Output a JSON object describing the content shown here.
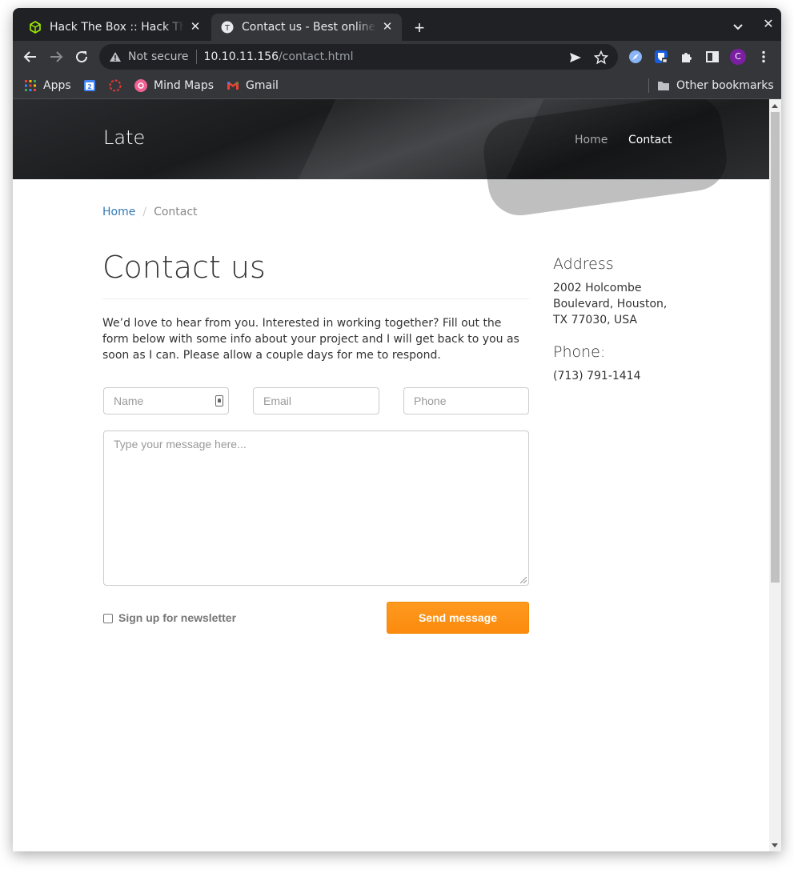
{
  "browser": {
    "tabs": [
      {
        "title": "Hack The Box :: Hack The Box",
        "icon": "hackthebox-cube-icon",
        "active": false
      },
      {
        "title": "Contact us - Best online image",
        "icon": "page-favicon-icon",
        "active": true
      }
    ],
    "url": {
      "security": "Not secure",
      "host": "10.10.11.156",
      "path": "/contact.html"
    },
    "bookmarks": [
      {
        "label": "Apps",
        "icon": "apps-grid-icon"
      },
      {
        "label": "",
        "icon": "google-calendar-icon"
      },
      {
        "label": "",
        "icon": "target-icon"
      },
      {
        "label": "Mind Maps",
        "icon": "mindmaps-icon"
      },
      {
        "label": "Gmail",
        "icon": "gmail-icon"
      }
    ],
    "other_bookmarks": "Other bookmarks",
    "profile_initial": "C"
  },
  "site": {
    "brand": "Late",
    "nav": {
      "home": "Home",
      "contact": "Contact"
    }
  },
  "breadcrumb": {
    "home": "Home",
    "separator": "/",
    "current": "Contact"
  },
  "page": {
    "title": "Contact us",
    "intro": "We’d love to hear from you. Interested in working together? Fill out the form below with some info about your project and I will get back to you as soon as I can. Please allow a couple days for me to respond."
  },
  "form": {
    "name_placeholder": "Name",
    "email_placeholder": "Email",
    "phone_placeholder": "Phone",
    "message_placeholder": "Type your message here...",
    "newsletter_label": "Sign up for newsletter",
    "newsletter_checked": false,
    "submit_label": "Send message"
  },
  "sidebar": {
    "address_heading": "Address",
    "address": "2002 Holcombe Boulevard, Houston, TX 77030, USA",
    "phone_heading": "Phone:",
    "phone": "(713) 791-1414"
  },
  "colors": {
    "accent": "#fd9418",
    "link": "#337ab7",
    "browser_dark": "#202124",
    "browser_toolbar": "#35363a"
  }
}
